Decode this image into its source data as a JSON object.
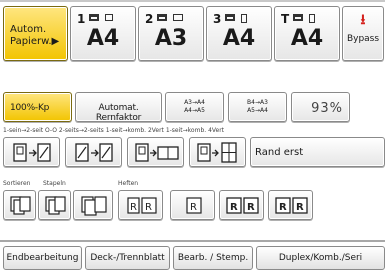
{
  "paper": {
    "auto_label_line1": "Autom.",
    "auto_label_line2": "Papierw.▶",
    "trays": [
      {
        "num": "1",
        "size": "A4"
      },
      {
        "num": "2",
        "size": "A3"
      },
      {
        "num": "3",
        "size": "A4"
      },
      {
        "num": "T",
        "size": "A4"
      }
    ],
    "bypass_icon": "⭳",
    "bypass_label": "Bypass"
  },
  "reduce": {
    "full_size_label": "100%-Kp",
    "auto_factor_label": "Automat. Rernfaktor",
    "ratio1_top": "A3→A4",
    "ratio1_bot": "A4→A5",
    "ratio2_top": "B4→A3",
    "ratio2_bot": "A5→A4",
    "zoom_value": "93%"
  },
  "duplex": {
    "caption": "1-sein→2-seit O-O   2-seits→2-seits   1-seit→komb. 2Vert  1-seit→komb. 4Vert",
    "rand_label": "Rand erst"
  },
  "finishing": {
    "sort_label": "Sortieren",
    "stack_label": "Stapeln",
    "staple_label": "Heften"
  },
  "tabs": [
    "Endbearbeitung",
    "Deck-/Trennblatt",
    "Bearb. / Stemp.",
    "Duplex/Komb./Seri"
  ],
  "colors": {
    "selected": "#f2c400",
    "bypass_icon": "#d4201c"
  }
}
